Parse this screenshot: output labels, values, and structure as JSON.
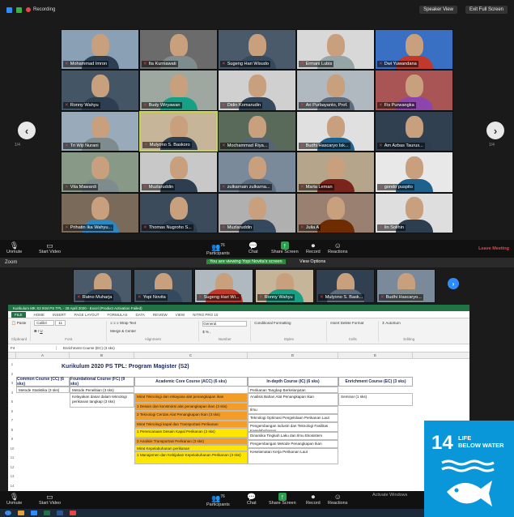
{
  "top_window": {
    "recording_label": "Recording",
    "speaker_view_label": "Speaker View",
    "exit_full_screen_label": "Exit Full Screen",
    "page_left": "1/4",
    "page_right": "1/4",
    "participants": [
      {
        "name": "Mohammad Imron"
      },
      {
        "name": "Ita Kurniawati"
      },
      {
        "name": "Sugeng Hari Wisudo"
      },
      {
        "name": "Ermani Lubis"
      },
      {
        "name": "Dwi Yuwandana"
      },
      {
        "name": "Ronny Wahyu"
      },
      {
        "name": "Budy Wiryawan"
      },
      {
        "name": "Didin Komarudin"
      },
      {
        "name": "Ari Purbayanto, Prof."
      },
      {
        "name": "Fis Purwangka"
      },
      {
        "name": "Tri Wiji Nurani"
      },
      {
        "name": "Mulyono S. Baskoro"
      },
      {
        "name": "Mochammad Riya..."
      },
      {
        "name": "Budhi Hascaryo Isk..."
      },
      {
        "name": "Am Azbas Taurus..."
      },
      {
        "name": "Vita Mawardi"
      },
      {
        "name": "Muzlaruddin"
      },
      {
        "name": "zulkarnain zulkarna..."
      },
      {
        "name": "Marta Leman"
      },
      {
        "name": "gondo puspito"
      },
      {
        "name": "Prihatin Ika Wahyu..."
      },
      {
        "name": "Thomas Nugroho S..."
      },
      {
        "name": "Muzlaruddin"
      },
      {
        "name": "Julia A"
      },
      {
        "name": "Iin Solihin"
      }
    ],
    "toolbar": {
      "unmute": "Unmute",
      "start_video": "Start Video",
      "participants": "Participants",
      "participants_count": "76",
      "chat": "Chat",
      "share_screen": "Share Screen",
      "record": "Record",
      "reactions": "Reactions",
      "leave": "Leave Meeting"
    }
  },
  "bottom_window": {
    "title": "Zoom",
    "viewing_banner": "You are viewing Yopi Novita's screen",
    "view_options": "View Options",
    "strip": [
      {
        "name": "Ratno Muharja"
      },
      {
        "name": "Yopi Novita"
      },
      {
        "name": "Sugeng Hari Wi..."
      },
      {
        "name": "Ronny Wahyu"
      },
      {
        "name": "Mulyono S. Bask..."
      },
      {
        "name": "Budhi Hascaryo..."
      }
    ],
    "excel": {
      "window_title": "Kurikulum MK S2 IKM PS TPL - 28 April 2020 - Excel (Product Activation Failed)",
      "tabs": [
        "FILE",
        "HOME",
        "INSERT",
        "PAGE LAYOUT",
        "FORMULAS",
        "DATA",
        "REVIEW",
        "VIEW",
        "NITRO PRO 10"
      ],
      "font_name": "Calibri",
      "font_size": "11",
      "cell_ref": "F4",
      "formula": "Enrichment Course (EC) (3 sks)",
      "col_letters": [
        "A",
        "B",
        "C",
        "D",
        "E"
      ],
      "sheet_title": "Kurikulum 2020 PS TPL: Program Magister (S2)",
      "headers": [
        "Common Course (CC) (6 sks)",
        "Foundational Course (FC) (9 sks)",
        "Academic Core Course (ACC) (6 sks)",
        "In-depth Course (IC) (6 sks)",
        "Enrichment Course (EC) (3 sks)"
      ],
      "rows": {
        "cc_1": "Metode Statistika (3 sks)",
        "fc_1": "Metode Penelitian (3 sks)",
        "fc_2": "Kelayakan dasar dalam teknologi perikanan tangkap (3 sks)",
        "acc_1": "Mirat Teknologi dan rekayasa alat penangkapan ikan",
        "acc_1a": "1 Desain dan konstruksi alat penangkapan ikan (3 sks)",
        "acc_1b": "2 Teknologi Cerdas Alat Penangkapan Ikan (3 sks)",
        "acc_2": "Mirat Teknologi kapal dan Transportasi Perikanan",
        "acc_2a": "1 Perencanaan Desain Kapal Perikanan (3 sks)",
        "acc_2b": "2 Analisis Transportasi Perikanan (3 sks)",
        "acc_3": "Mirat Kepelabuhanan perikanan",
        "acc_3a": "1 Manajemen dan Kebijakan Kepelabuhanan Perikanan (3 sks)",
        "ic_1": "Perikanan Tangkap Berkelanjutan",
        "ic_2": "Analisis Bahan Alat Penangkapan Ikan",
        "ic_3": "Ilmu",
        "ic_4": "Teknologi Optimasi Pengelolaan Perikanan Laut",
        "ic_5": "Pengembangan industri dan Teknologi Fasilitas Kepelabuhanan",
        "ic_6": "Dinamika Tingkah Laku dan Ilmu Ekosistem",
        "ic_7": "Pengembangan Metode Penangkapan Ikan",
        "ic_8": "Keselamatan Kerja Perikanan Laut",
        "ec_1": "Seminar (1 sks)"
      },
      "row_numbers": [
        "1",
        "2",
        "3",
        "4",
        "5",
        "6",
        "7",
        "8",
        "9",
        "10",
        "11",
        "12",
        "13",
        "14"
      ]
    },
    "toolbar": {
      "unmute": "Unmute",
      "start_video": "Start Video",
      "participants": "Participants",
      "participants_count": "76",
      "chat": "Chat",
      "share_screen": "Share Screen",
      "record": "Record",
      "reactions": "Reactions"
    },
    "watermark": "Activate Windows"
  },
  "sdg": {
    "number": "14",
    "line1": "LIFE",
    "line2": "BELOW WATER",
    "color": "#0a97d9"
  }
}
